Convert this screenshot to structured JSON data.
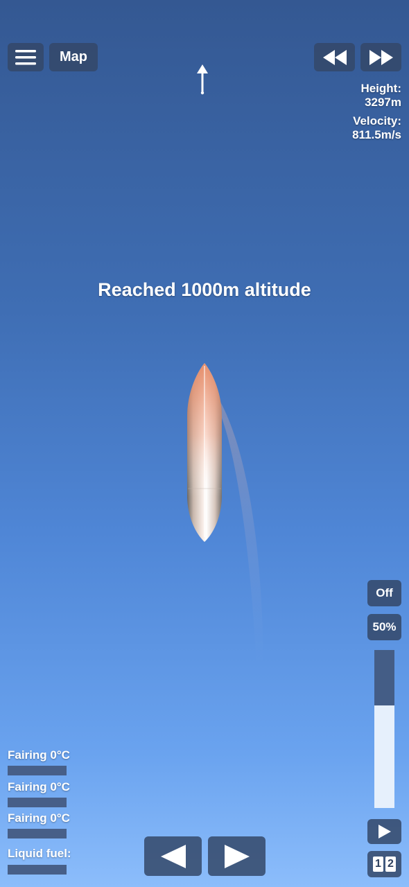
{
  "toolbar": {
    "menu_icon": "hamburger-menu-icon",
    "map_label": "Map",
    "rewind_icon": "rewind-icon",
    "fast_forward_icon": "fast-forward-icon",
    "direction_icon": "up-arrow-direction-icon"
  },
  "telemetry": {
    "height_label": "Height:",
    "height_value": "3297m",
    "velocity_label": "Velocity:",
    "velocity_value": "811.5m/s"
  },
  "message": "Reached 1000m altitude",
  "controls": {
    "engine_toggle": "Off",
    "throttle_percent_label": "50%",
    "throttle_level": 0.35,
    "play_icon": "play-icon",
    "stage_digits": [
      "1",
      "2"
    ]
  },
  "resources": [
    {
      "label": "Fairing 0°C"
    },
    {
      "label": "Fairing 0°C"
    },
    {
      "label": "Fairing 0°C"
    },
    {
      "label": "Liquid fuel:"
    }
  ],
  "rotate": {
    "left_icon": "rotate-left-triangle-icon",
    "right_icon": "rotate-right-triangle-icon"
  },
  "colors": {
    "sky_top": "#345892",
    "sky_bottom": "#8cbdfb",
    "button_bg": "#344868",
    "throttle_track": "#e6f0fc",
    "throttle_fill": "#445d86"
  }
}
